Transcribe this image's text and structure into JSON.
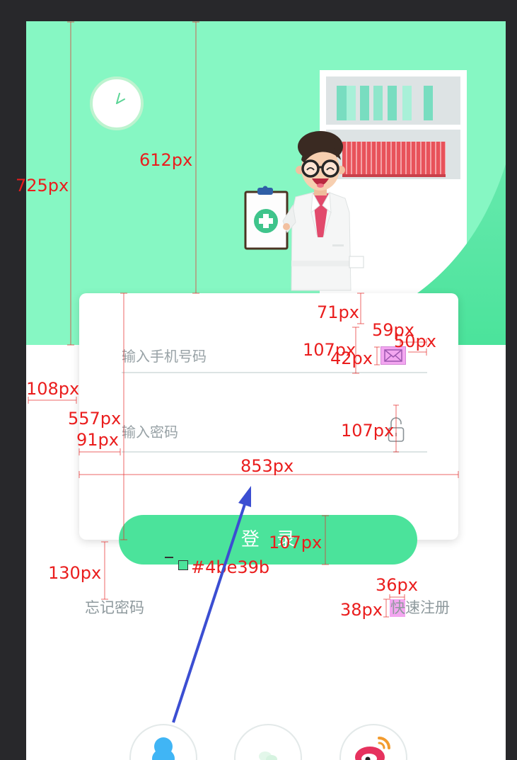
{
  "screen": {
    "phone_placeholder": "输入手机号码",
    "password_placeholder": "输入密码",
    "login_label": "登 录",
    "forgot_password": "忘记密码",
    "quick_register": "快速注册"
  },
  "icons": {
    "wall_clock": "clock-icon",
    "phone_field": "mail-icon",
    "password_field": "lock-icon",
    "social": [
      "qq-icon",
      "wechat-icon",
      "weibo-icon"
    ]
  },
  "spec_annotations": {
    "labels": [
      "725px",
      "612px",
      "71px",
      "59px",
      "50px",
      "107px",
      "42px",
      "108px",
      "557px",
      "91px",
      "107px",
      "853px",
      "107px",
      "130px",
      "36px",
      "38px"
    ],
    "color_label": "#4be39b"
  },
  "colors": {
    "canvas_bg": "#28282b",
    "mint": "#86f7c3",
    "accent": "#4be39b",
    "hint_gray": "#98a2a6",
    "highlight_pink": "#f3a6f0",
    "annotation_red": "#ea1d1d",
    "arrow_blue": "#3b4ed2"
  }
}
